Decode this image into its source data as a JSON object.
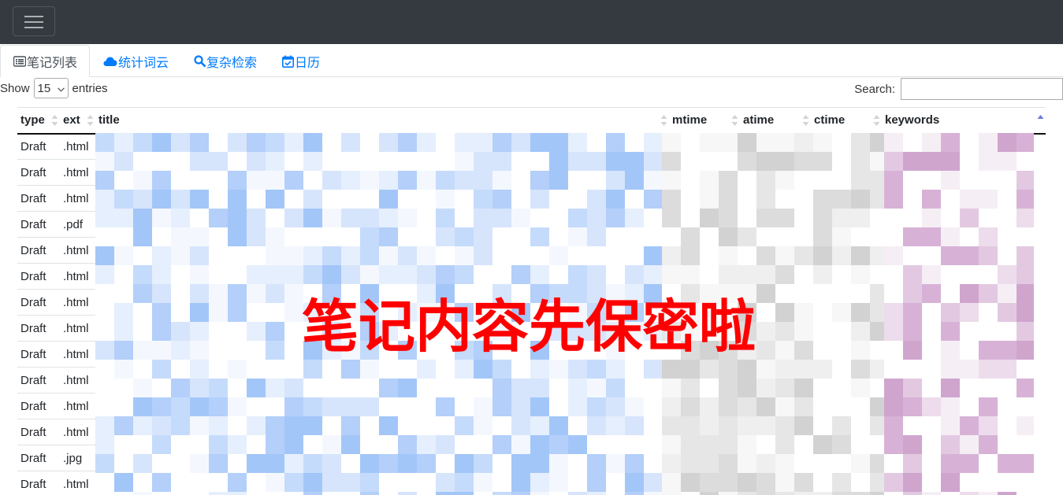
{
  "navbar": {
    "menu_icon": "hamburger-menu-icon"
  },
  "tabs": [
    {
      "label": "笔记列表",
      "icon": "list-alt-icon",
      "active": true
    },
    {
      "label": "统计词云",
      "icon": "cloud-icon",
      "active": false
    },
    {
      "label": "复杂检索",
      "icon": "search-icon",
      "active": false
    },
    {
      "label": "日历",
      "icon": "calendar-check-icon",
      "active": false
    }
  ],
  "length_control": {
    "show_label": "Show",
    "value": "15",
    "entries_label": "entries"
  },
  "search": {
    "label": "Search:",
    "value": ""
  },
  "table": {
    "columns": [
      "type",
      "ext",
      "title",
      "mtime",
      "atime",
      "ctime",
      "keywords"
    ],
    "sorted_column": "keywords",
    "sort_direction": "asc",
    "rows": [
      {
        "type": "Draft",
        "ext": ".html"
      },
      {
        "type": "Draft",
        "ext": ".html"
      },
      {
        "type": "Draft",
        "ext": ".html"
      },
      {
        "type": "Draft",
        "ext": ".pdf"
      },
      {
        "type": "Draft",
        "ext": ".html"
      },
      {
        "type": "Draft",
        "ext": ".html"
      },
      {
        "type": "Draft",
        "ext": ".html"
      },
      {
        "type": "Draft",
        "ext": ".html"
      },
      {
        "type": "Draft",
        "ext": ".html"
      },
      {
        "type": "Draft",
        "ext": ".html"
      },
      {
        "type": "Draft",
        "ext": ".html"
      },
      {
        "type": "Draft",
        "ext": ".html"
      },
      {
        "type": "Draft",
        "ext": ".jpg"
      },
      {
        "type": "Draft",
        "ext": ".html"
      }
    ]
  },
  "overlay": {
    "text": "笔记内容先保密啦",
    "color": "#ff0000"
  },
  "colors": {
    "navbar_bg": "#343a40",
    "link": "#007bff",
    "title_mosaic": "#bcd6fb",
    "time_mosaic": "#d9d9d9",
    "keyword_mosaic": "#d7b2d6"
  }
}
